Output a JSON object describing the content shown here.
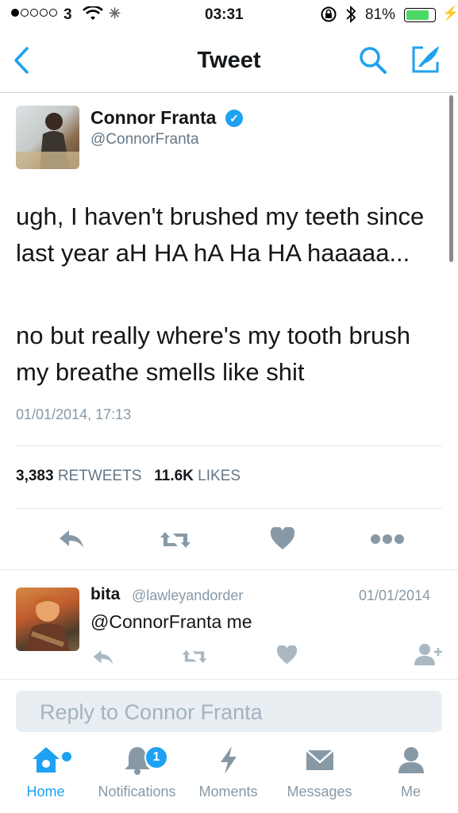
{
  "status_bar": {
    "carrier": "3",
    "time": "03:31",
    "battery_pct": "81%",
    "battery_level": 0.81,
    "icons": [
      "signal-dots-icon",
      "wifi-icon",
      "activity-spinner-icon",
      "orientation-lock-icon",
      "bluetooth-icon",
      "battery-icon",
      "charging-bolt-icon"
    ]
  },
  "nav": {
    "title": "Tweet",
    "icons": [
      "back-chevron-icon",
      "search-icon",
      "compose-icon"
    ],
    "accent": "#1da1f2"
  },
  "tweet": {
    "author_name": "Connor Franta",
    "author_handle": "@ConnorFranta",
    "verified": true,
    "text_1": "ugh, I haven't brushed my teeth since last year aH HA hA Ha HA haaaaa...",
    "text_2": "no but really where's my tooth brush my breathe smells like shit",
    "date": "01/01/2014, 17:13",
    "retweets_count": "3,383",
    "retweets_label": "RETWEETS",
    "likes_count": "11.6K",
    "likes_label": "LIKES",
    "actions": [
      "reply-icon",
      "retweet-icon",
      "like-heart-icon",
      "more-dots-icon"
    ]
  },
  "reply": {
    "author_name": "bita",
    "author_handle": "@lawleyandorder",
    "date": "01/01/2014",
    "text": "@ConnorFranta me",
    "actions": [
      "reply-icon",
      "retweet-icon",
      "like-heart-icon",
      "follow-icon"
    ]
  },
  "composer": {
    "placeholder": "Reply to Connor Franta"
  },
  "tab_bar": {
    "tabs": [
      {
        "label": "Home",
        "icon": "home-icon",
        "active": true
      },
      {
        "label": "Notifications",
        "icon": "notifications-bell-icon",
        "active": false
      },
      {
        "label": "Moments",
        "icon": "moments-lightning-icon",
        "active": false
      },
      {
        "label": "Messages",
        "icon": "messages-envelope-icon",
        "active": false
      },
      {
        "label": "Me",
        "icon": "profile-person-icon",
        "active": false
      }
    ],
    "notifications_badge": "1"
  }
}
